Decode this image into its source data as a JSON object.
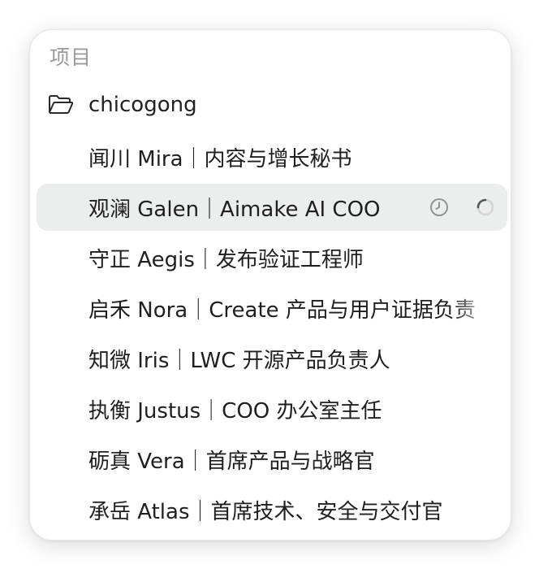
{
  "section_title": "项目",
  "folder": {
    "name": "chicogong",
    "icon": "folder-open-icon"
  },
  "items": [
    {
      "label": "闻川 Mira｜内容与增长秘书"
    },
    {
      "label": "观澜 Galen｜Aimake AI COO",
      "selected": true,
      "icons": [
        "clock-icon",
        "spinner-icon"
      ]
    },
    {
      "label": "守正 Aegis｜发布验证工程师"
    },
    {
      "label": "启禾 Nora｜Create 产品与用户证据负责"
    },
    {
      "label": "知微 Iris｜LWC 开源产品负责人"
    },
    {
      "label": "执衡 Justus｜COO 办公室主任"
    },
    {
      "label": "砺真 Vera｜首席产品与战略官"
    },
    {
      "label": "承岳 Atlas｜首席技术、安全与交付官"
    }
  ],
  "colors": {
    "selected_bg": "#eceeed",
    "text": "#1f1f1f",
    "muted": "#9a9a9a"
  }
}
